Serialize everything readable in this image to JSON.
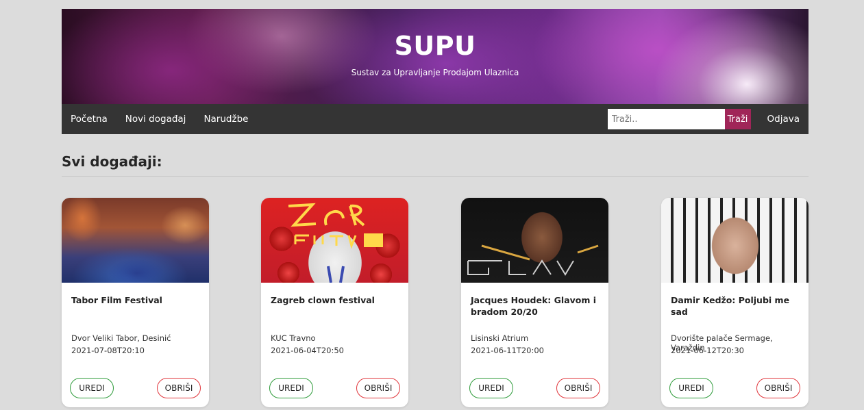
{
  "header": {
    "title": "SUPU",
    "subtitle": "Sustav za Upravljanje Prodajom Ulaznica"
  },
  "nav": {
    "items": [
      "Početna",
      "Novi događaj",
      "Narudžbe"
    ],
    "search_placeholder": "Traži..",
    "search_button": "Traži",
    "logout": "Odjava"
  },
  "section": {
    "title": "Svi događaji:"
  },
  "card_actions": {
    "edit": "UREDI",
    "delete": "OBRIŠI"
  },
  "events": [
    {
      "name": "Tabor Film Festival",
      "venue": "Dvor Veliki Tabor, Desinić",
      "date": "2021-07-08T20:10"
    },
    {
      "name": "Zagreb clown festival",
      "venue": "KUC Travno",
      "date": "2021-06-04T20:50"
    },
    {
      "name": "Jacques Houdek: Glavom i bradom 20/20",
      "venue": "Lisinski Atrium",
      "date": "2021-06-11T20:00"
    },
    {
      "name": "Damir Kedžo: Poljubi me sad",
      "venue": "Dvorište palače Sermage, Varaždin",
      "date": "2021-06-12T20:30"
    }
  ],
  "colors": {
    "nav_bg": "#343434",
    "search_button": "#a02558",
    "edit_border": "#2e9b3a",
    "delete_border": "#e0353b",
    "page_bg": "#dcdcdc"
  }
}
